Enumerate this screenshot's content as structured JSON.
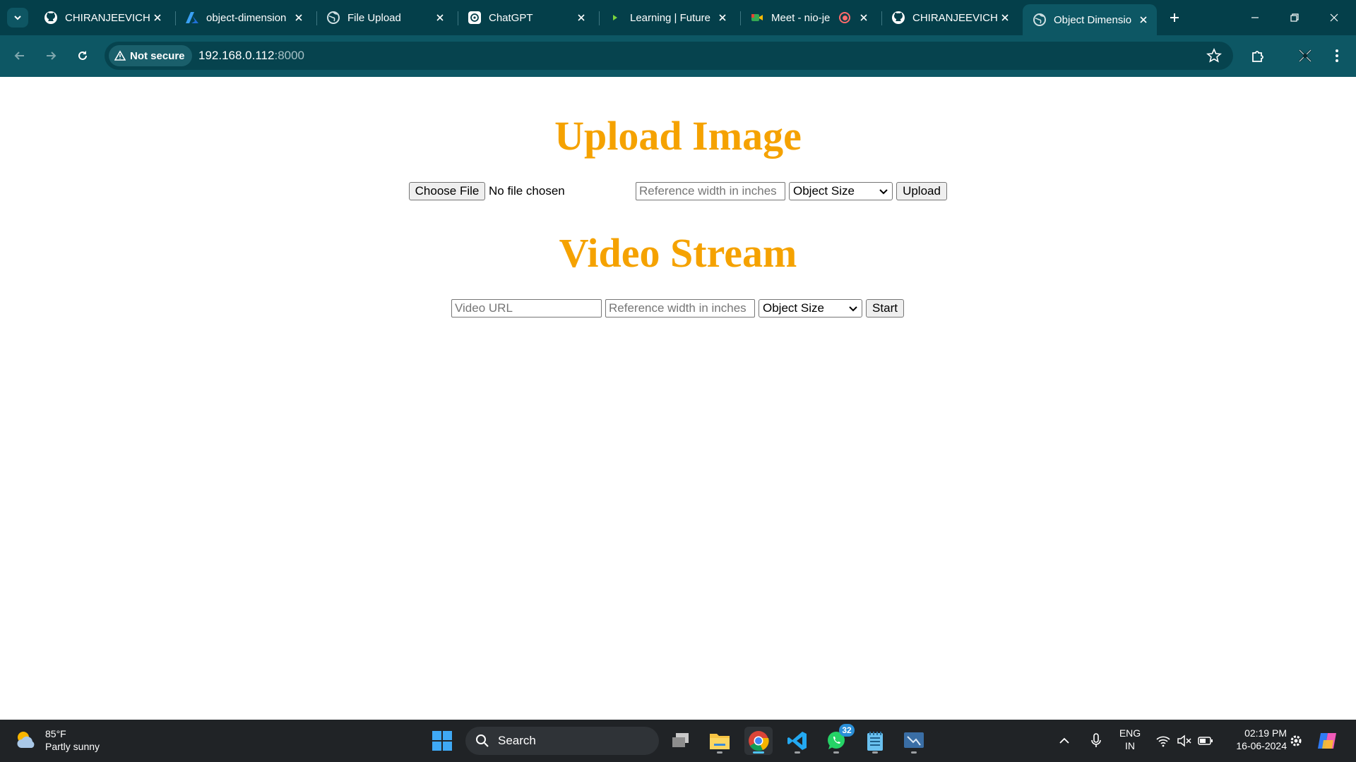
{
  "browser": {
    "tabs": [
      {
        "title": "CHIRANJEEVICHI",
        "icon": "github-icon"
      },
      {
        "title": "object-dimension",
        "icon": "azure-icon"
      },
      {
        "title": "File Upload",
        "icon": "globe-icon"
      },
      {
        "title": "ChatGPT",
        "icon": "chatgpt-icon"
      },
      {
        "title": "Learning | Future",
        "icon": "play-icon"
      },
      {
        "title": "Meet - nio-je",
        "icon": "meet-icon"
      },
      {
        "title": "CHIRANJEEVICHI",
        "icon": "github-icon"
      },
      {
        "title": "Object Dimensio",
        "icon": "globe-icon",
        "active": true
      }
    ],
    "security_label": "Not secure",
    "url_host": "192.168.0.112",
    "url_port": ":8000"
  },
  "page": {
    "upload_heading": "Upload Image",
    "choose_file_label": "Choose File",
    "no_file_text": "No file chosen",
    "reference_placeholder": "Reference width in inches",
    "object_size_selected": "Object Size",
    "upload_button": "Upload",
    "video_heading": "Video Stream",
    "video_url_placeholder": "Video URL",
    "video_reference_placeholder": "Reference width in inches",
    "video_object_size_selected": "Object Size",
    "start_button": "Start",
    "heading_color": "#f5a200"
  },
  "taskbar": {
    "weather_temp": "85°F",
    "weather_desc": "Partly sunny",
    "search_label": "Search",
    "whatsapp_badge": "32",
    "lang_primary": "ENG",
    "lang_secondary": "IN",
    "time": "02:19 PM",
    "date": "16-06-2024"
  }
}
